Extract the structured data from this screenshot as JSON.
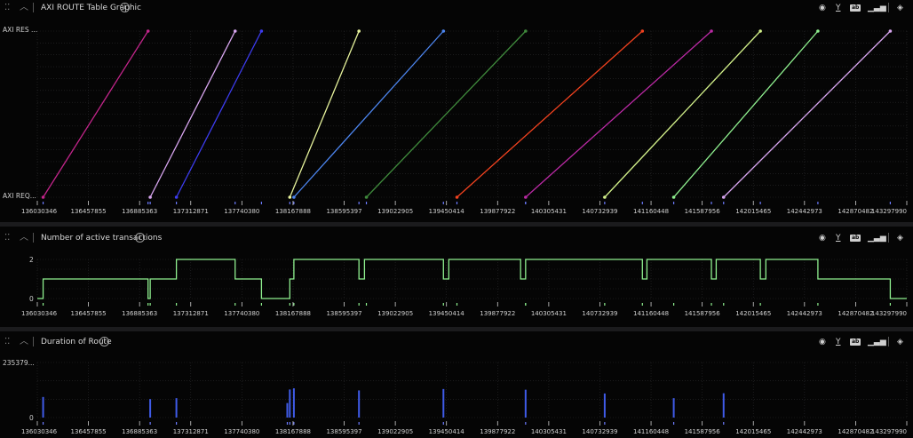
{
  "x_ticks": [
    "136030346",
    "136457855",
    "136885363",
    "137312871",
    "137740380",
    "138167888",
    "138595397",
    "139022905",
    "139450414",
    "139877922",
    "140305431",
    "140732939",
    "141160448",
    "141587956",
    "142015465",
    "142442973",
    "142870482",
    "143297990"
  ],
  "x_range": [
    136030346,
    143297990
  ],
  "toolbar": {
    "filter_label": "Y",
    "view_icon": "eye-icon",
    "chart_icon": "bar-chart-icon",
    "layers_icon": "layers-icon"
  },
  "panels": [
    {
      "title": "AXI ROUTE Table Graphic",
      "y_top_label": "AXI RES ...",
      "y_bottom_label": "AXI REQ..."
    },
    {
      "title": "Number of active transactions",
      "y_top_label": "2",
      "y_bottom_label": "0"
    },
    {
      "title": "Duration of Route",
      "y_top_label": "235379...",
      "y_bottom_label": "0"
    }
  ],
  "chart_data": [
    {
      "type": "line",
      "title": "AXI ROUTE Table Graphic",
      "y_categories": [
        "AXI REQ...",
        "AXI RES ..."
      ],
      "series": [
        {
          "color": "#c2258a",
          "x": [
            136079000,
            136956000
          ],
          "y": [
            "AXI REQ...",
            "AXI RES ..."
          ]
        },
        {
          "color": "#d8a6f0",
          "x": [
            136974000,
            137684000
          ],
          "y": [
            "AXI REQ...",
            "AXI RES ..."
          ]
        },
        {
          "color": "#3d3cf0",
          "x": [
            137193000,
            137904000
          ],
          "y": [
            "AXI REQ...",
            "AXI RES ..."
          ]
        },
        {
          "color": "#e7f39c",
          "x": [
            138141000,
            138719000
          ],
          "y": [
            "AXI REQ...",
            "AXI RES ..."
          ]
        },
        {
          "color": "#4d86f0",
          "x": [
            138175000,
            139425000
          ],
          "y": [
            "AXI REQ...",
            "AXI RES ..."
          ]
        },
        {
          "color": "#3f8a3c",
          "x": [
            138781000,
            140112000
          ],
          "y": [
            "AXI REQ...",
            "AXI RES ..."
          ]
        },
        {
          "color": "#f2421f",
          "x": [
            139538000,
            141088000
          ],
          "y": [
            "AXI REQ...",
            "AXI RES ..."
          ]
        },
        {
          "color": "#bb2aa5",
          "x": [
            140112000,
            141665000
          ],
          "y": [
            "AXI REQ...",
            "AXI RES ..."
          ]
        },
        {
          "color": "#d2f08a",
          "x": [
            140773000,
            142074000
          ],
          "y": [
            "AXI REQ...",
            "AXI RES ..."
          ]
        },
        {
          "color": "#8ff08f",
          "x": [
            141350000,
            142555000
          ],
          "y": [
            "AXI REQ...",
            "AXI RES ..."
          ]
        },
        {
          "color": "#d8a6f0",
          "x": [
            141767000,
            143160000
          ],
          "y": [
            "AXI REQ...",
            "AXI RES ..."
          ]
        }
      ],
      "grid": true
    },
    {
      "type": "line",
      "title": "Number of active transactions",
      "step": true,
      "color": "#8ff08f",
      "ylim": [
        0,
        2
      ],
      "x": [
        136030346,
        136079000,
        136956000,
        136974000,
        137020000,
        137193000,
        137684000,
        137904000,
        138141000,
        138175000,
        138719000,
        138765000,
        139425000,
        139470000,
        140070000,
        140112000,
        141088000,
        141126000,
        141665000,
        141705000,
        142074000,
        142120000,
        142555000,
        143160000,
        143297990
      ],
      "y": [
        0,
        1,
        0,
        1,
        1,
        2,
        1,
        0,
        1,
        2,
        1,
        2,
        1,
        2,
        1,
        2,
        1,
        2,
        1,
        2,
        1,
        2,
        1,
        0,
        0
      ]
    },
    {
      "type": "bar",
      "title": "Duration of Route",
      "color": "#3f5be8",
      "ylim": [
        0,
        2353790
      ],
      "x": [
        136079000,
        136974000,
        137193000,
        138120000,
        138141000,
        138175000,
        138719000,
        139425000,
        140112000,
        140773000,
        141350000,
        141767000
      ],
      "values": [
        880000,
        790000,
        830000,
        620000,
        1200000,
        1250000,
        1160000,
        1220000,
        1190000,
        1030000,
        830000,
        1040000
      ]
    }
  ]
}
